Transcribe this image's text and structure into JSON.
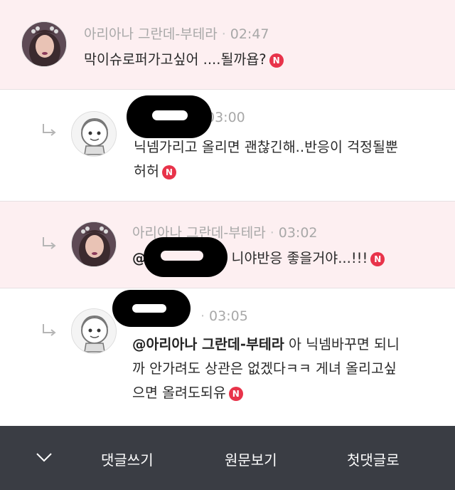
{
  "comments": [
    {
      "author": "아리아나 그란데-부테라",
      "time": "02:47",
      "text": "막이슈로퍼가고싶어 ....될까욥?",
      "badge": "N"
    },
    {
      "author": "",
      "time": "03:00",
      "text_line1": "닉넴가리고 올리면 괜찮긴해..반응이 걱정될뿐",
      "text_line2": "허허",
      "badge": "N"
    },
    {
      "author": "아리아나 그란데-부테라",
      "time": "03:02",
      "mention": "@",
      "text": "니야반응 좋을거야...!!!",
      "badge": "N"
    },
    {
      "author": "",
      "time": "03:05",
      "mention": "@아리아나 그란데-부테라",
      "text_line1": " 아 닉넴바꾸면 되니",
      "text_line2": "까 안가려도 상관은 없겠다ㅋㅋ 게녀 올리고싶",
      "text_line3": "으면 올려도되유",
      "badge": "N"
    }
  ],
  "bottom_bar": {
    "write_comment": "댓글쓰기",
    "view_original": "원문보기",
    "first_comment": "첫댓글로"
  },
  "icons": {
    "reply": "reply-arrow-icon",
    "collapse": "chevron-down-icon",
    "new_badge": "new-badge-icon"
  },
  "colors": {
    "highlight_bg": "#fdeff1",
    "badge": "#e8334a",
    "bottom_bar": "#3a3d44"
  }
}
